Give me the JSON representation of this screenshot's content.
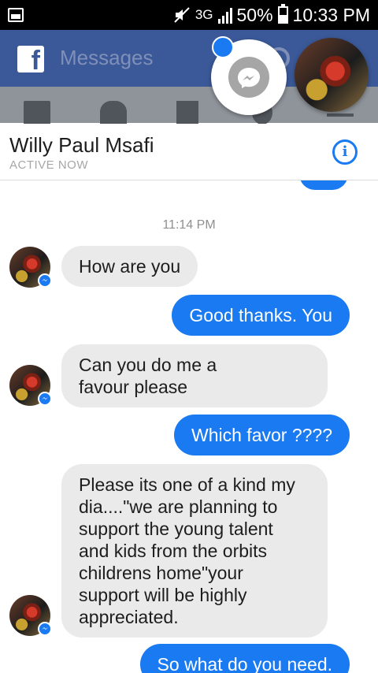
{
  "status_bar": {
    "network": "3G",
    "battery": "50%",
    "time": "10:33 PM",
    "icons": [
      "picture-icon",
      "mute-icon",
      "signal-icon",
      "battery-icon"
    ]
  },
  "app": {
    "title": "Messages",
    "brand_color": "#3b5998",
    "accent_color": "#1a7af2"
  },
  "conversation": {
    "contact_name": "Willy Paul Msafi",
    "contact_status": "ACTIVE NOW",
    "timestamp": "11:14 PM",
    "messages": [
      {
        "from": "them",
        "text": "How are you"
      },
      {
        "from": "me",
        "text": "Good thanks. You"
      },
      {
        "from": "them",
        "text": "Can you do me a\nfavour please"
      },
      {
        "from": "me",
        "text": "Which favor ????"
      },
      {
        "from": "them",
        "text": "Please its one of a kind my\ndia....\"we are planning to\nsupport the young talent\nand kids from the orbits\nchildrens home\"your\nsupport will be highly\nappreciated."
      },
      {
        "from": "me",
        "text": "So what do you need."
      }
    ]
  }
}
